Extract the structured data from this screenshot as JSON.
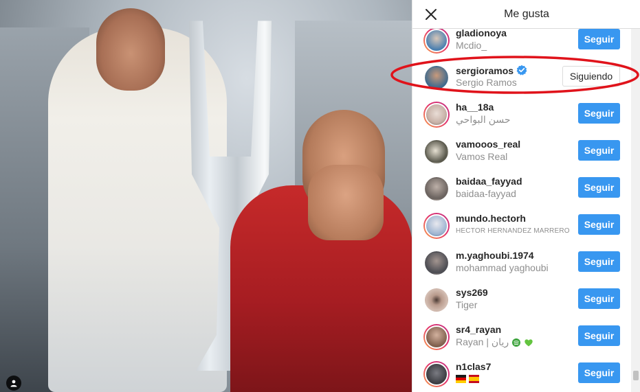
{
  "dialog": {
    "title": "Me gusta",
    "follow_label": "Seguir",
    "following_label": "Siguiendo"
  },
  "likes": [
    {
      "username": "gladionoya",
      "fullname": "Mcdio_",
      "state": "follow",
      "ring": true,
      "avatar_color": "#4a7fb0"
    },
    {
      "username": "sergioramos",
      "fullname": "Sergio Ramos",
      "state": "following",
      "ring": false,
      "verified": true,
      "avatar_color": "#3e6a8e"
    },
    {
      "username": "ha__18a",
      "fullname": "حسن البواحي",
      "state": "follow",
      "ring": true,
      "avatar_color": "#c8b2a8"
    },
    {
      "username": "vamooos_real",
      "fullname": "Vamos Real",
      "state": "follow",
      "ring": false,
      "avatar_color": "#5b5a4e"
    },
    {
      "username": "baidaa_fayyad",
      "fullname": "baidaa-fayyad",
      "state": "follow",
      "ring": false,
      "avatar_color": "#6d6561"
    },
    {
      "username": "mundo.hectorh",
      "fullname": "HECTOR HERNANDEZ MARRERO",
      "state": "follow",
      "ring": true,
      "avatar_color": "#9fb5d1"
    },
    {
      "username": "m.yaghoubi.1974",
      "fullname": "mohammad yaghoubi",
      "state": "follow",
      "ring": false,
      "avatar_color": "#4f4f55"
    },
    {
      "username": "sys269",
      "fullname": "Tiger",
      "state": "follow",
      "ring": false,
      "avatar_color": "#b89a8c"
    },
    {
      "username": "sr4_rayan",
      "fullname": "Rayan | ريان",
      "state": "follow",
      "ring": true,
      "avatar_color": "#7e5e4c"
    },
    {
      "username": "n1clas7",
      "fullname": "",
      "state": "follow",
      "ring": true,
      "avatar_color": "#3a3b40"
    }
  ],
  "icons": {
    "close": "close-icon",
    "verified": "verified-badge-icon",
    "user_tag": "user-tag-icon"
  },
  "colors": {
    "follow_button": "#3897f0",
    "highlight_ellipse": "#e0131b",
    "story_ring_start": "#f9a24b",
    "story_ring_end": "#c13584"
  }
}
